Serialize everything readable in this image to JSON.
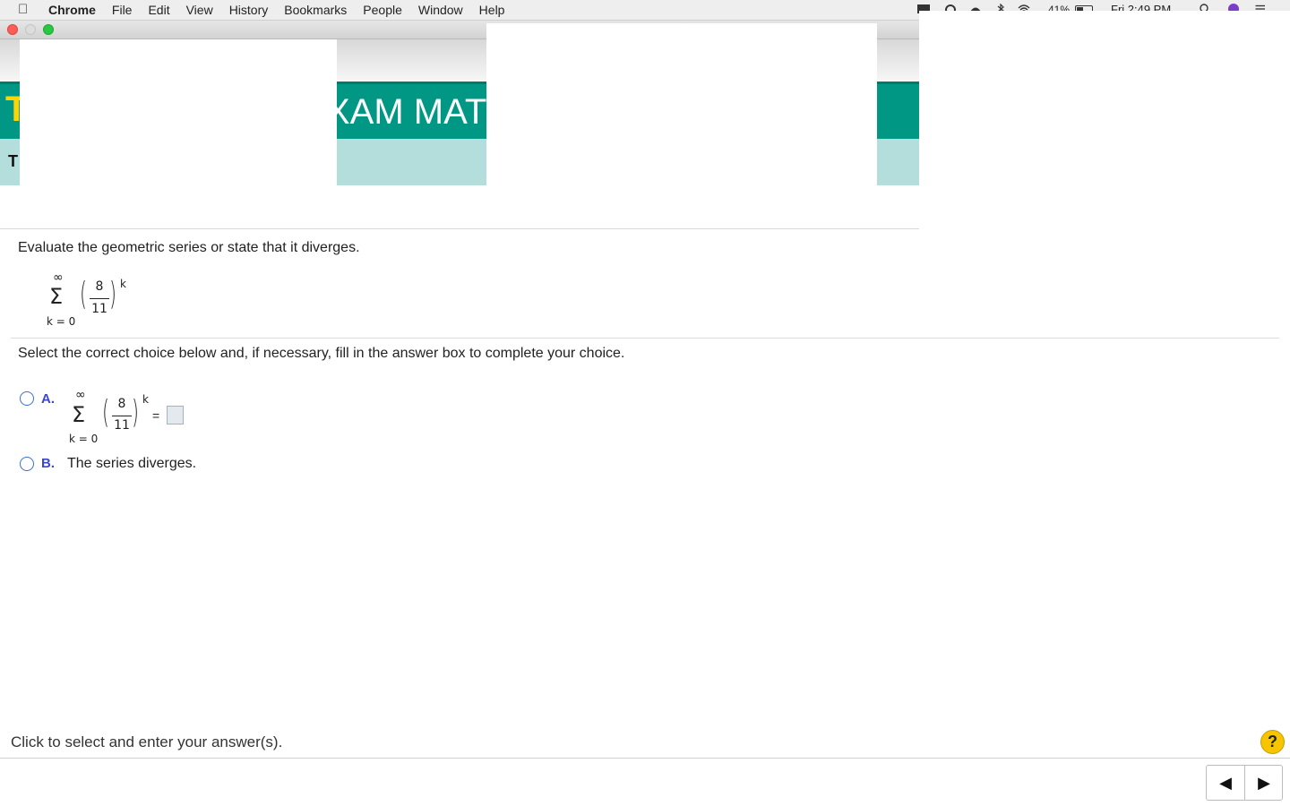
{
  "menubar": {
    "apple_symbol": "",
    "app_name": "Chrome",
    "menus": [
      "File",
      "Edit",
      "View",
      "History",
      "Bookmarks",
      "People",
      "Window",
      "Help"
    ],
    "battery": "41%",
    "clock": "Fri 2:49 PM",
    "status_icons": [
      "adobe-icon",
      "creative-cloud-icon",
      "backup-icon",
      "bluetooth-icon",
      "wifi-icon",
      "battery-icon",
      "search-icon",
      "siri-icon",
      "notification-center-icon"
    ]
  },
  "site": {
    "logo_letter": "T",
    "title_fragment": "XAM MAT",
    "subbar_letter": "T"
  },
  "question": {
    "prompt": "Evaluate the geometric series or state that it diverges.",
    "series": {
      "upper": "∞",
      "sigma": "Σ",
      "lower": "k = 0",
      "numerator": "8",
      "denominator": "11",
      "exponent": "k"
    },
    "instruction": "Select the correct choice below and, if necessary, fill in the answer box to complete your choice.",
    "choices": [
      {
        "letter": "A.",
        "equals": "=",
        "answer_value": ""
      },
      {
        "letter": "B.",
        "text": "The series diverges."
      }
    ]
  },
  "footer": {
    "hint": "Click to select and enter your answer(s).",
    "help_label": "?",
    "prev_icon": "◀",
    "next_icon": "▶"
  },
  "colors": {
    "teal": "#009884",
    "light_teal": "#b3dedb",
    "choice_letter": "#3b47c9",
    "help_yellow": "#f7c500"
  }
}
